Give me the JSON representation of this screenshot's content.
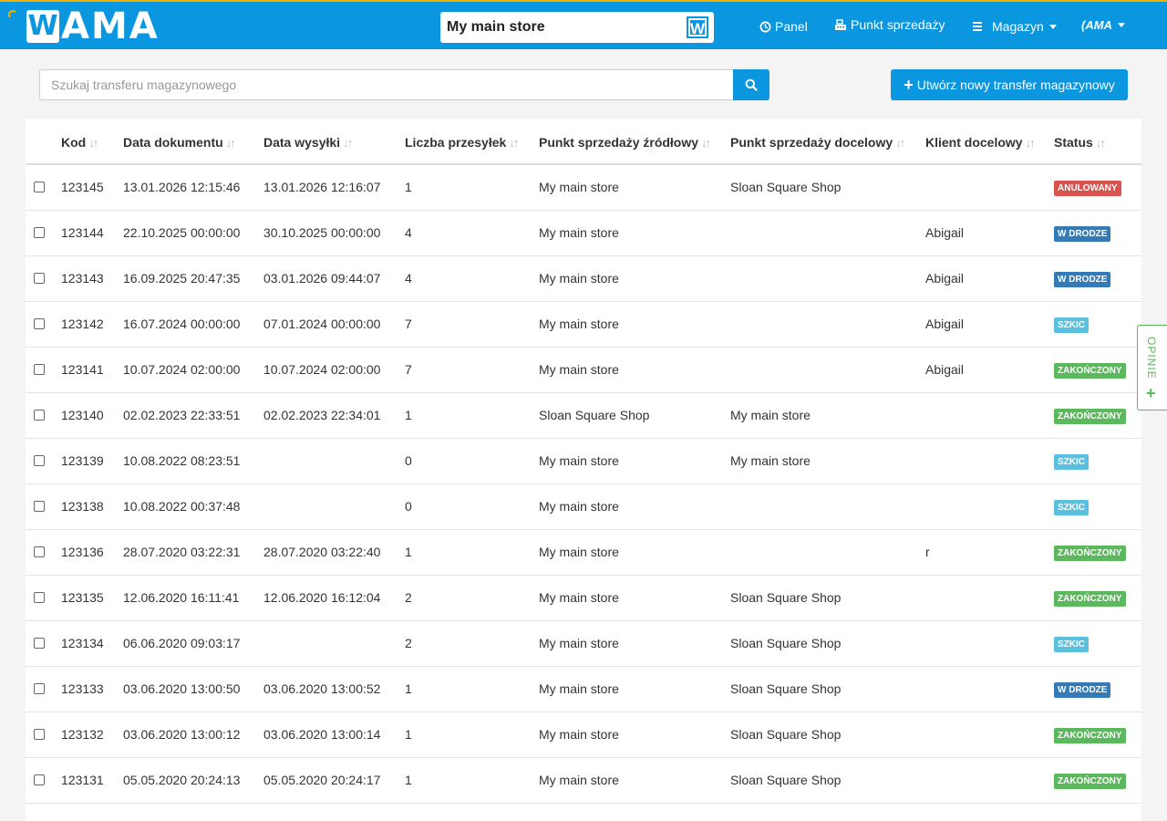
{
  "brand": {
    "logo_letter": "W",
    "logo_text": "AMA"
  },
  "header": {
    "store_name": "My main store",
    "store_icon_letter": "W",
    "nav": {
      "panel": "Panel",
      "pos": "Punkt sprzedaży",
      "warehouse": "Magazyn",
      "user": "(AMA"
    }
  },
  "search": {
    "placeholder": "Szukaj transferu magazynowego"
  },
  "create_button": {
    "label": "Utwórz nowy transfer magazynowy"
  },
  "table": {
    "columns": [
      "Kod",
      "Data dokumentu",
      "Data wysyłki",
      "Liczba przesyłek",
      "Punkt sprzedaży źródłowy",
      "Punkt sprzedaży docelowy",
      "Klient docelowy",
      "Status"
    ],
    "rows": [
      {
        "code": "123145",
        "doc_date": "13.01.2026 12:15:46",
        "ship_date": "13.01.2026 12:16:07",
        "count": "1",
        "source": "My main store",
        "target": "Sloan Square Shop",
        "client": "",
        "status": "ANULOWANY",
        "status_type": "cancel"
      },
      {
        "code": "123144",
        "doc_date": "22.10.2025 00:00:00",
        "ship_date": "30.10.2025 00:00:00",
        "count": "4",
        "source": "My main store",
        "target": "",
        "client": "Abigail",
        "status": "W DRODZE",
        "status_type": "road"
      },
      {
        "code": "123143",
        "doc_date": "16.09.2025 20:47:35",
        "ship_date": "03.01.2026 09:44:07",
        "count": "4",
        "source": "My main store",
        "target": "",
        "client": "Abigail",
        "status": "W DRODZE",
        "status_type": "road"
      },
      {
        "code": "123142",
        "doc_date": "16.07.2024 00:00:00",
        "ship_date": "07.01.2024 00:00:00",
        "count": "7",
        "source": "My main store",
        "target": "",
        "client": "Abigail",
        "status": "SZKIC",
        "status_type": "draft"
      },
      {
        "code": "123141",
        "doc_date": "10.07.2024 02:00:00",
        "ship_date": "10.07.2024 02:00:00",
        "count": "7",
        "source": "My main store",
        "target": "",
        "client": "Abigail",
        "status": "ZAKOŃCZONY",
        "status_type": "done"
      },
      {
        "code": "123140",
        "doc_date": "02.02.2023 22:33:51",
        "ship_date": "02.02.2023 22:34:01",
        "count": "1",
        "source": "Sloan Square Shop",
        "target": "My main store",
        "client": "",
        "status": "ZAKOŃCZONY",
        "status_type": "done"
      },
      {
        "code": "123139",
        "doc_date": "10.08.2022 08:23:51",
        "ship_date": "",
        "count": "0",
        "source": "My main store",
        "target": "My main store",
        "client": "",
        "status": "SZKIC",
        "status_type": "draft"
      },
      {
        "code": "123138",
        "doc_date": "10.08.2022 00:37:48",
        "ship_date": "",
        "count": "0",
        "source": "My main store",
        "target": "",
        "client": "",
        "status": "SZKIC",
        "status_type": "draft"
      },
      {
        "code": "123136",
        "doc_date": "28.07.2020 03:22:31",
        "ship_date": "28.07.2020 03:22:40",
        "count": "1",
        "source": "My main store",
        "target": "",
        "client": "r",
        "status": "ZAKOŃCZONY",
        "status_type": "done"
      },
      {
        "code": "123135",
        "doc_date": "12.06.2020 16:11:41",
        "ship_date": "12.06.2020 16:12:04",
        "count": "2",
        "source": "My main store",
        "target": "Sloan Square Shop",
        "client": "",
        "status": "ZAKOŃCZONY",
        "status_type": "done"
      },
      {
        "code": "123134",
        "doc_date": "06.06.2020 09:03:17",
        "ship_date": "",
        "count": "2",
        "source": "My main store",
        "target": "Sloan Square Shop",
        "client": "",
        "status": "SZKIC",
        "status_type": "draft"
      },
      {
        "code": "123133",
        "doc_date": "03.06.2020 13:00:50",
        "ship_date": "03.06.2020 13:00:52",
        "count": "1",
        "source": "My main store",
        "target": "Sloan Square Shop",
        "client": "",
        "status": "W DRODZE",
        "status_type": "road"
      },
      {
        "code": "123132",
        "doc_date": "03.06.2020 13:00:12",
        "ship_date": "03.06.2020 13:00:14",
        "count": "1",
        "source": "My main store",
        "target": "Sloan Square Shop",
        "client": "",
        "status": "ZAKOŃCZONY",
        "status_type": "done"
      },
      {
        "code": "123131",
        "doc_date": "05.05.2020 20:24:13",
        "ship_date": "05.05.2020 20:24:17",
        "count": "1",
        "source": "My main store",
        "target": "Sloan Square Shop",
        "client": "",
        "status": "ZAKOŃCZONY",
        "status_type": "done"
      }
    ]
  },
  "feedback": {
    "label": "OPINIE",
    "icon": "plus-icon"
  },
  "colors": {
    "brand": "#0b96e0",
    "accent": "#f0b400",
    "cancel": "#d9534f",
    "road": "#337ab7",
    "draft": "#5bc0de",
    "done": "#5cb85c"
  }
}
